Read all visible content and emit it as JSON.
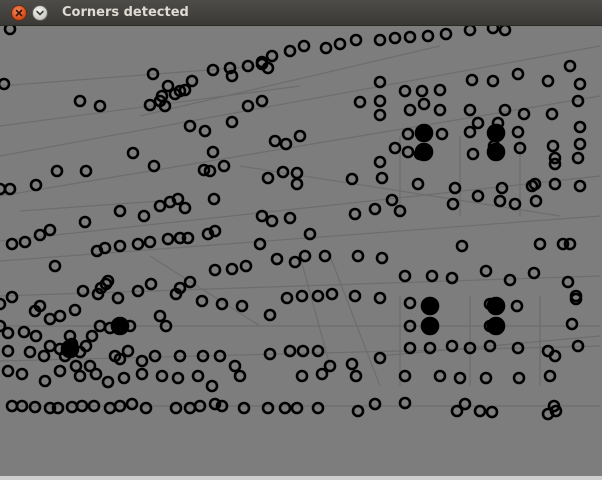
{
  "window": {
    "title": "Corners detected"
  },
  "icons": {
    "close": "close-icon",
    "minimize": "chevron-down-icon"
  },
  "colors": {
    "titlebar": "#3f3e3a",
    "close_button": "#e0572a",
    "canvas_background": "#7d7d7d",
    "corner_marker": "#000000"
  }
}
